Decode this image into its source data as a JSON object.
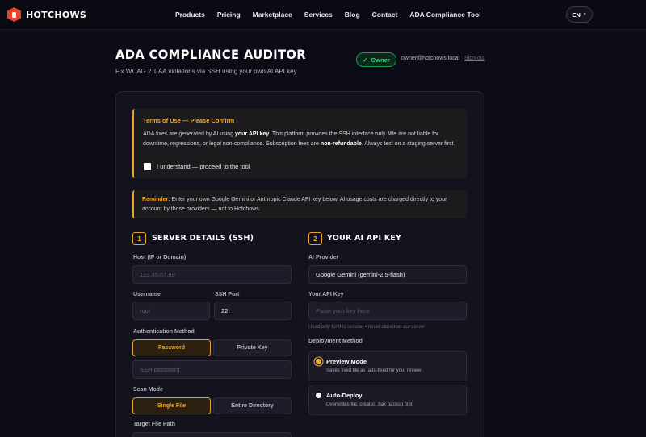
{
  "nav": {
    "brand": "HOTCHOWS",
    "links": [
      "Products",
      "Pricing",
      "Marketplace",
      "Services",
      "Blog",
      "Contact",
      "ADA Compliance Tool"
    ],
    "language": "EN"
  },
  "header": {
    "title": "ADA COMPLIANCE AUDITOR",
    "subtitle": "Fix WCAG 2.1 AA violations via SSH using your own AI API key",
    "role_badge": "Owner",
    "email": "owner@hotchows.local",
    "signout": "Sign out"
  },
  "terms": {
    "title": "Terms of Use — Please Confirm",
    "body_1": "ADA fixes are generated by AI using ",
    "body_bold_1": "your API key",
    "body_2": ". This platform provides the SSH interface only. We are not liable for downtime, regressions, or legal non-compliance. Subscription fees are ",
    "body_bold_2": "non-refundable",
    "body_3": ". Always test on a staging server first.",
    "checkbox_label": "I understand — proceed to the tool"
  },
  "reminder": {
    "label": "Reminder:",
    "text": " Enter your own Google Gemini or Anthropic Claude API key below. AI usage costs are charged directly to your account by those providers — not to Hotchows."
  },
  "server": {
    "number": "1",
    "title": "SERVER DETAILS (SSH)",
    "host_label": "Host (IP or Domain)",
    "host_placeholder": "123.45.67.89",
    "username_label": "Username",
    "username_placeholder": "root",
    "port_label": "SSH Port",
    "port_value": "22",
    "auth_label": "Authentication Method",
    "auth_password": "Password",
    "auth_key": "Private Key",
    "password_placeholder": "SSH password",
    "scan_label": "Scan Mode",
    "scan_single": "Single File",
    "scan_dir": "Entire Directory",
    "target_label": "Target File Path"
  },
  "ai": {
    "number": "2",
    "title": "YOUR AI API KEY",
    "provider_label": "AI Provider",
    "provider_value": "Google Gemini (gemini-2.5-flash)",
    "key_label": "Your API Key",
    "key_placeholder": "Paste your key here",
    "key_hint": "Used only for this session • never stored on our server",
    "deploy_label": "Deployment Method",
    "preview_title": "Preview Mode",
    "preview_desc": "Saves fixed file as .ada-fixed for your review",
    "auto_title": "Auto-Deploy",
    "auto_desc": "Overwrites file, creates .bak backup first"
  },
  "colors": {
    "accent": "#f0a928",
    "success": "#3fd080",
    "brand": "#e8432e",
    "background": "#0d0c16"
  }
}
